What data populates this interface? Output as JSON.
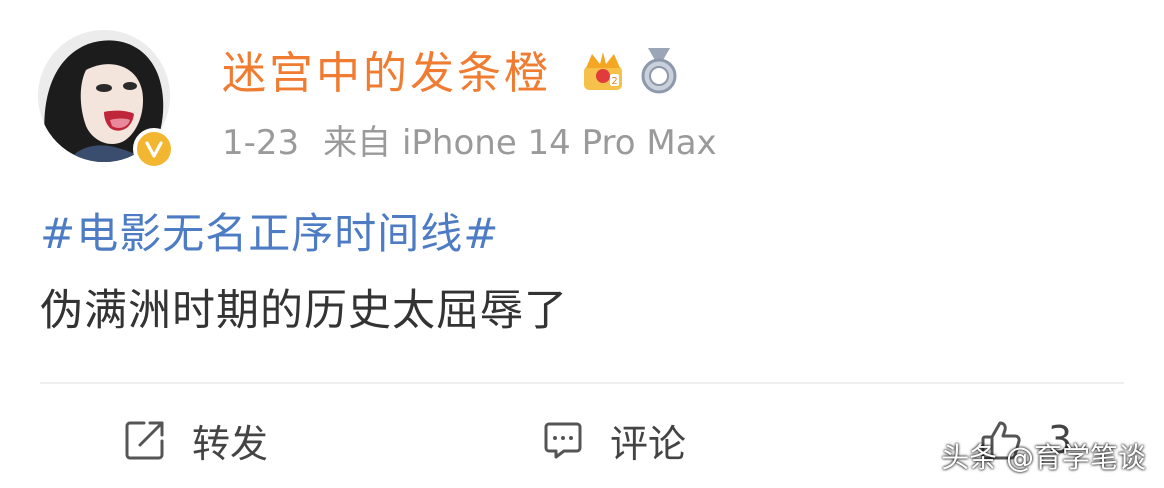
{
  "post": {
    "username": "迷宫中的发条橙",
    "time": "1-23",
    "source": "来自 iPhone 14 Pro Max",
    "topic": "#电影无名正序时间线#",
    "text": "伪满洲时期的历史太屈辱了"
  },
  "icons": {
    "avatar": "avatar-image",
    "verified": "verified-badge-icon",
    "vip": "vip-crown-icon",
    "medal": "medal-icon",
    "repost": "repost-icon",
    "comment": "comment-icon",
    "like": "thumbs-up-icon"
  },
  "actions": {
    "repost_label": "转发",
    "comment_label": "评论",
    "like_count": "3"
  },
  "watermark": "头条 @育学笔谈",
  "colors": {
    "username": "#f07c32",
    "topic": "#4d7cc4",
    "meta": "#9a9a9a",
    "verified": "#f2b630"
  }
}
